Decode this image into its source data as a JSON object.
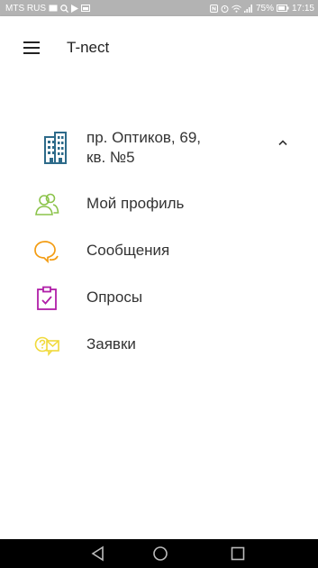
{
  "status_bar": {
    "carrier": "MTS RUS",
    "battery": "75%",
    "time": "17:15"
  },
  "app_bar": {
    "title": "T-nect",
    "menu_icon": "hamburger-menu-icon"
  },
  "drawer": {
    "address": {
      "line1": "пр. Оптиков, 69,",
      "line2": "кв. №5",
      "icon": "building-icon"
    },
    "items": [
      {
        "label": "Мой профиль",
        "icon": "profile-icon",
        "color": "#8bc34a"
      },
      {
        "label": "Сообщения",
        "icon": "chat-icon",
        "color": "#f39c12"
      },
      {
        "label": "Опросы",
        "icon": "survey-clipboard-icon",
        "color": "#b01ea8"
      },
      {
        "label": "Заявки",
        "icon": "requests-icon",
        "color": "#f0d93a"
      }
    ]
  },
  "colors": {
    "status_bar": "#b3b3b3",
    "building": "#2e6b8a",
    "nav_bar": "#000000"
  }
}
